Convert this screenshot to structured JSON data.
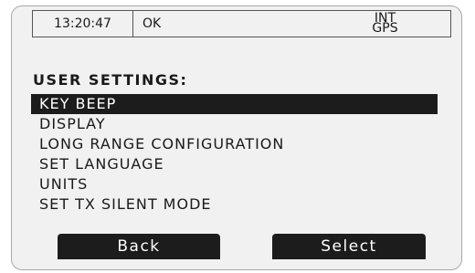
{
  "status": {
    "time": "13:20:47",
    "state": "OK",
    "source_line1": "INT",
    "source_line2": "GPS"
  },
  "screen": {
    "title": "USER SETTINGS:",
    "items": [
      {
        "label": "KEY BEEP",
        "selected": true
      },
      {
        "label": "DISPLAY",
        "selected": false
      },
      {
        "label": "LONG RANGE CONFIGURATION",
        "selected": false
      },
      {
        "label": "SET LANGUAGE",
        "selected": false
      },
      {
        "label": "UNITS",
        "selected": false
      },
      {
        "label": "SET TX SILENT MODE",
        "selected": false
      }
    ]
  },
  "softkeys": {
    "left_label": "Back",
    "right_label": "Select"
  },
  "colors": {
    "highlight": "#1c1c1c",
    "screen_background": "#f1f1f1"
  }
}
